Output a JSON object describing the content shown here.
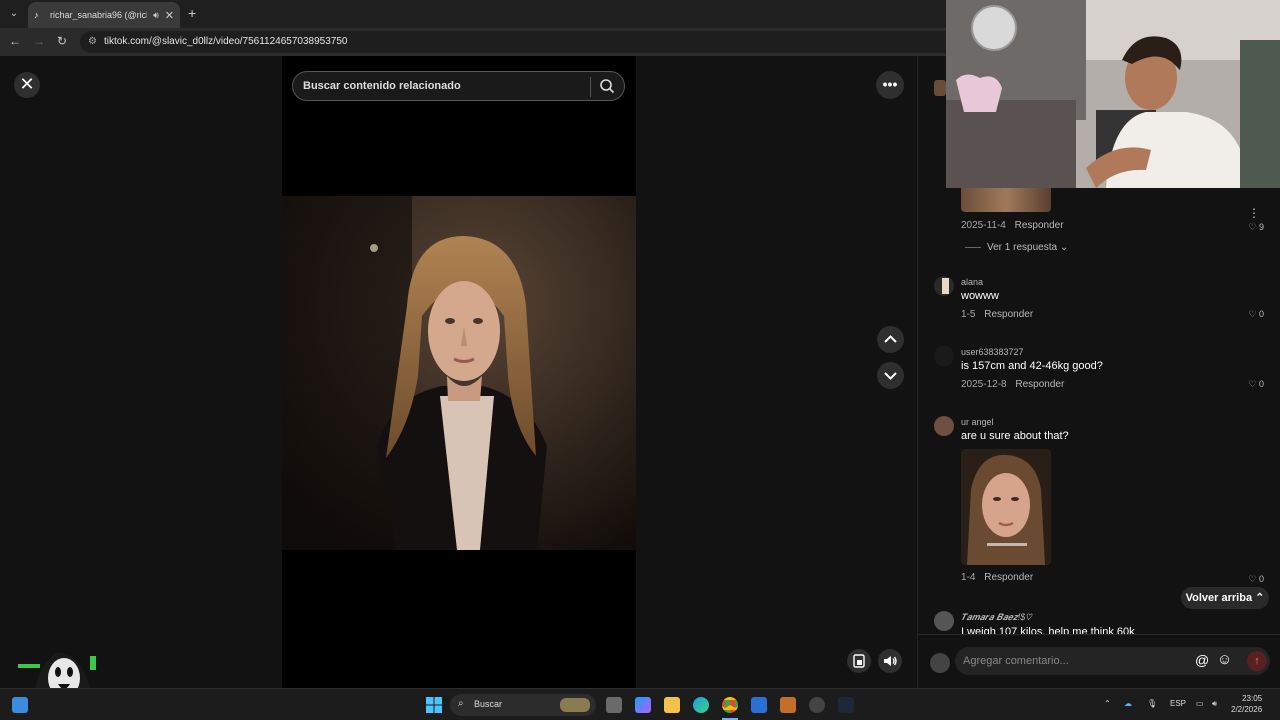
{
  "browser": {
    "tab_title": "richar_sanabria96 (@richar...",
    "new_tab": "+",
    "url": "tiktok.com/@slavic_d0llz/video/7561124657038953750"
  },
  "viewer": {
    "close": "✕",
    "search_placeholder": "Buscar contenido relacionado",
    "more": "•••"
  },
  "comments": {
    "top_item": {
      "date": "2025-11-4",
      "reply": "Responder",
      "likes": "9",
      "more": "⋮",
      "view_replies": "Ver 1 respuesta"
    },
    "items": [
      {
        "user": "alana",
        "text": "wowww",
        "date": "1-5",
        "reply": "Responder",
        "likes": "0"
      },
      {
        "user": "user638383727",
        "text": "is 157cm and 42-46kg good?",
        "date": "2025-12-8",
        "reply": "Responder",
        "likes": "0"
      },
      {
        "user": "ur angel",
        "text": "are u sure about that?",
        "date": "1-4",
        "reply": "Responder",
        "likes": "0"
      },
      {
        "user": "𝑻𝒂𝒎𝒂𝒓𝒂 𝑩𝒂𝒆𝒛!$♡",
        "text": "I weigh 107 kilos, help me think 60k",
        "date": "",
        "reply": "",
        "likes": ""
      }
    ],
    "back_to_top": "Volver arriba",
    "add_comment_placeholder": "Agregar comentario..."
  },
  "taskbar": {
    "search": "Buscar",
    "lang": "ESP",
    "time": "23:05",
    "date": "2/2/2026"
  }
}
